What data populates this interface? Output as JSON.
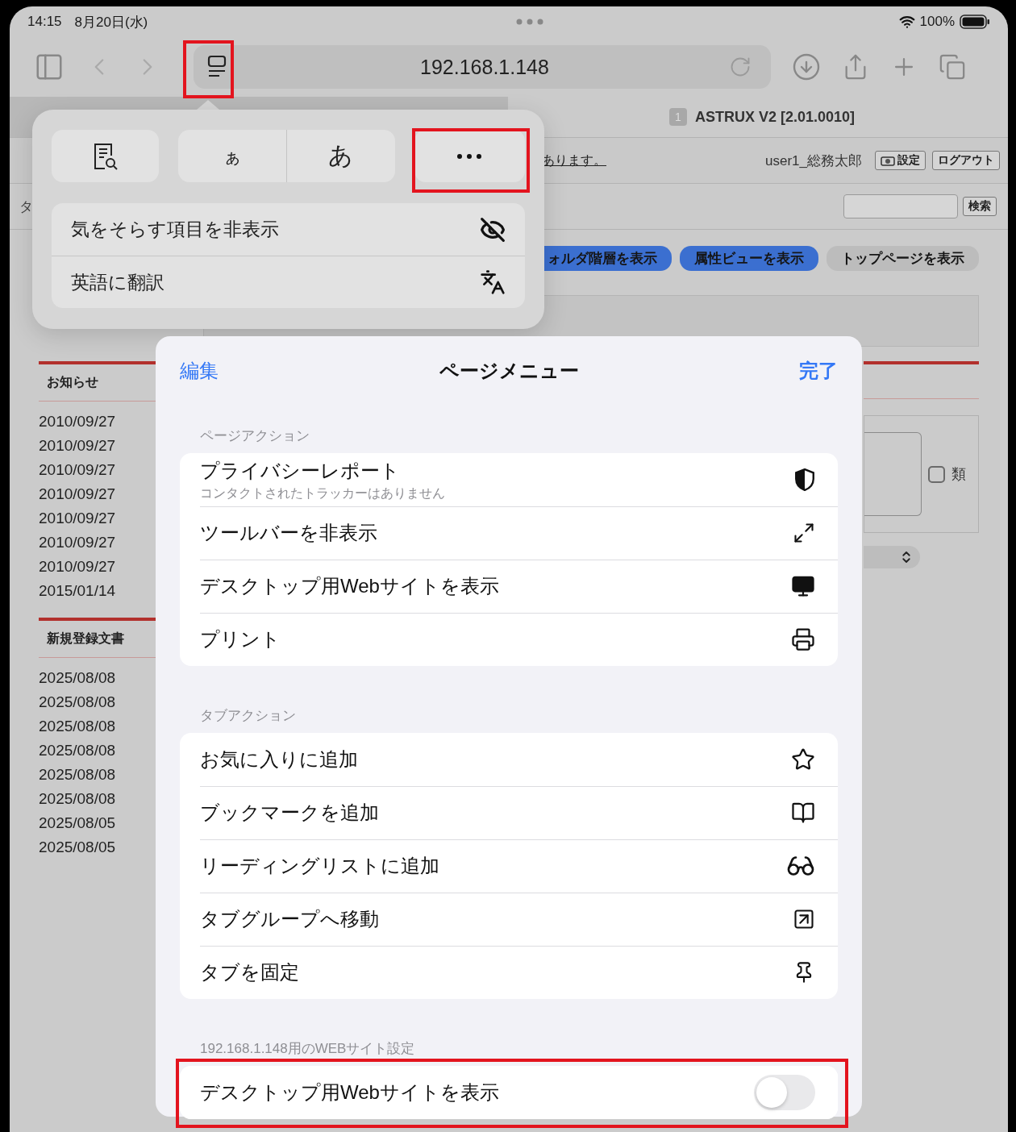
{
  "status_bar": {
    "time": "14:15",
    "date": "8月20日(水)",
    "battery": "100%"
  },
  "toolbar": {
    "url": "192.168.1.148",
    "reader_button": {
      "highlighted": true
    }
  },
  "page": {
    "app_badge": "1",
    "app_title": "ASTRUX V2 [2.01.0010]",
    "notice": "あります。",
    "user": "user1_総務太郎",
    "settings_button": "設定",
    "logout_button": "ログアウト",
    "tab_fragment": "タ",
    "search_button": "検索",
    "view_buttons": [
      {
        "label": "ォルダ階層を表示",
        "kind": "primary"
      },
      {
        "label": "属性ビューを表示",
        "kind": "primary"
      },
      {
        "label": "トップページを表示",
        "kind": "plain"
      }
    ],
    "notices": {
      "title": "お知らせ",
      "dates": [
        "2010/09/27",
        "2010/09/27",
        "2010/09/27",
        "2010/09/27",
        "2010/09/27",
        "2010/09/27",
        "2010/09/27",
        "2015/01/14"
      ]
    },
    "new_documents": {
      "title": "新規登録文書",
      "dates": [
        "2025/08/08",
        "2025/08/08",
        "2025/08/08",
        "2025/08/08",
        "2025/08/08",
        "2025/08/08",
        "2025/08/05",
        "2025/08/05"
      ]
    },
    "filter_checkbox": {
      "label": "類",
      "checked": false
    }
  },
  "popover": {
    "text_size": {
      "smaller": "ぁ",
      "larger": "あ"
    },
    "more_button": {
      "highlighted": true
    },
    "rows": [
      "気をそらす項目を非表示",
      "英語に翻訳"
    ]
  },
  "sheet": {
    "edit": "編集",
    "title": "ページメニュー",
    "done": "完了",
    "sections": [
      {
        "title": "ページアクション",
        "items": [
          {
            "kind": "action",
            "label": "プライバシーレポート",
            "subtitle": "コンタクトされたトラッカーはありません"
          },
          {
            "kind": "action",
            "label": "ツールバーを非表示"
          },
          {
            "kind": "action",
            "label": "デスクトップ用Webサイトを表示"
          },
          {
            "kind": "action",
            "label": "プリント"
          }
        ]
      },
      {
        "title": "タブアクション",
        "items": [
          {
            "kind": "action",
            "label": "お気に入りに追加"
          },
          {
            "kind": "action",
            "label": "ブックマークを追加"
          },
          {
            "kind": "action",
            "label": "リーディングリストに追加"
          },
          {
            "kind": "action",
            "label": "タブグループへ移動"
          },
          {
            "kind": "action",
            "label": "タブを固定"
          }
        ]
      },
      {
        "title": "192.168.1.148用のWEBサイト設定",
        "items": [
          {
            "kind": "toggle",
            "label": "デスクトップ用Webサイトを表示",
            "on": false,
            "highlighted": true
          }
        ]
      }
    ]
  }
}
